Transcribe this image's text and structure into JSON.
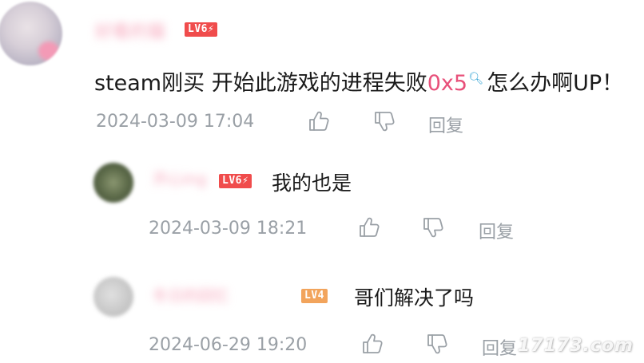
{
  "comments": {
    "main": {
      "username": "好看的猫",
      "level": "LV6⚡",
      "text_before": "steam刚买 开始此游戏的进程失败",
      "keyword": "0x5",
      "search_icon": "search-icon",
      "text_after": "怎么办啊UP！",
      "timestamp": "2024-03-09 17:04",
      "reply_label": "回复"
    },
    "replies": [
      {
        "username": "开心ing",
        "level": "LV6⚡",
        "text": "我的也是",
        "timestamp": "2024-03-09 18:21",
        "reply_label": "回复"
      },
      {
        "username": "冬日的回忆",
        "level": "LV4",
        "text": "哥们解决了吗",
        "timestamp": "2024-06-29 19:20",
        "reply_label": "回复"
      }
    ]
  },
  "colors": {
    "username": "#f7a9bd",
    "level_red": "#f04c4c",
    "level_orange": "#f2a45c",
    "keyword": "#e8507a",
    "meta_gray": "#9aa0a6"
  },
  "watermark": "17173.com"
}
